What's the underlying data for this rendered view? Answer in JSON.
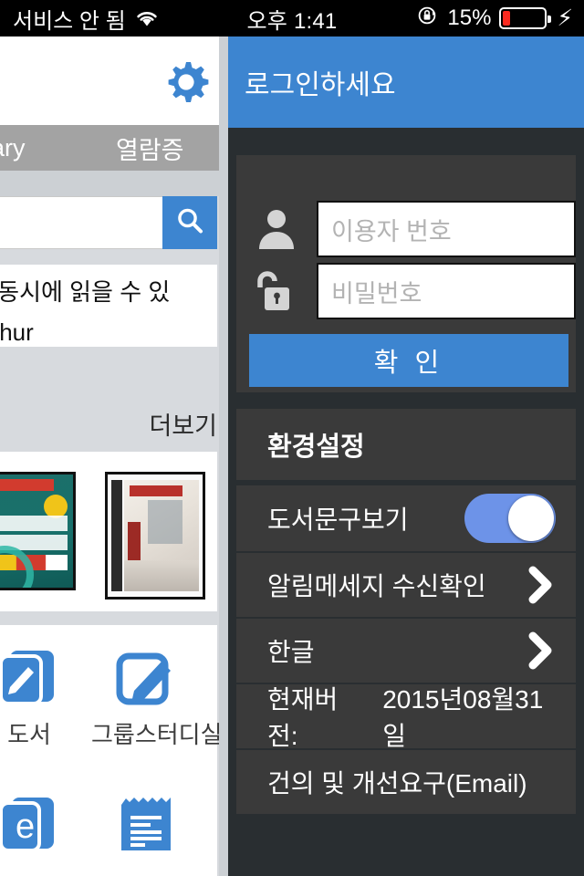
{
  "status_bar": {
    "carrier": "서비스 안 됨",
    "wifi_icon": "wifi-icon",
    "time": "오후 1:41",
    "rotation_lock_icon": "rotation-lock-icon",
    "battery_percent": "15%",
    "battery_level": 15,
    "charging_icon": "lightning-bolt-icon"
  },
  "background_app": {
    "gear_icon": "gear-icon",
    "tabs": [
      {
        "label": "ibrary"
      },
      {
        "label": "열람증"
      }
    ],
    "search": {
      "value": "",
      "placeholder": "",
      "button_icon": "search-icon"
    },
    "notice": {
      "line1": "를 동시에 읽을 수 있",
      "line2": "Arthur"
    },
    "more_link": "더보기",
    "book_covers": [
      {
        "name": "유통관리사 study book cover"
      },
      {
        "name": "interior design book cover"
      }
    ],
    "menu": [
      {
        "icon": "book-pencil-icon",
        "label": "도서"
      },
      {
        "icon": "edit-square-icon",
        "label": "그룹스터디실"
      },
      {
        "icon": "ebook-icon",
        "label": ""
      },
      {
        "icon": "notepad-icon",
        "label": ""
      }
    ]
  },
  "panel": {
    "header_title": "로그인하세요",
    "login": {
      "user_icon": "person-icon",
      "user_placeholder": "이용자 번호",
      "user_value": "",
      "password_icon": "unlock-padlock-icon",
      "password_placeholder": "비밀번호",
      "password_value": "",
      "submit_label": "확 인"
    },
    "settings": {
      "section_title": "환경설정",
      "rows": [
        {
          "label": "도서문구보기",
          "control": "toggle",
          "toggle_on": true
        },
        {
          "label": "알림메세지 수신확인",
          "control": "chevron"
        },
        {
          "label": "한글",
          "control": "chevron"
        },
        {
          "label": "현재버전:",
          "value": "2015년08월31일",
          "control": "none"
        },
        {
          "label": "건의 및 개선요구(Email)",
          "control": "none"
        }
      ]
    }
  },
  "colors": {
    "accent_blue": "#3d85d0",
    "toggle_blue": "#6d93e8",
    "panel_bg": "#292e31",
    "card_bg": "#3a3a3a",
    "battery_red": "#fb2a20",
    "tabbar_gray": "#a3a3a3"
  }
}
